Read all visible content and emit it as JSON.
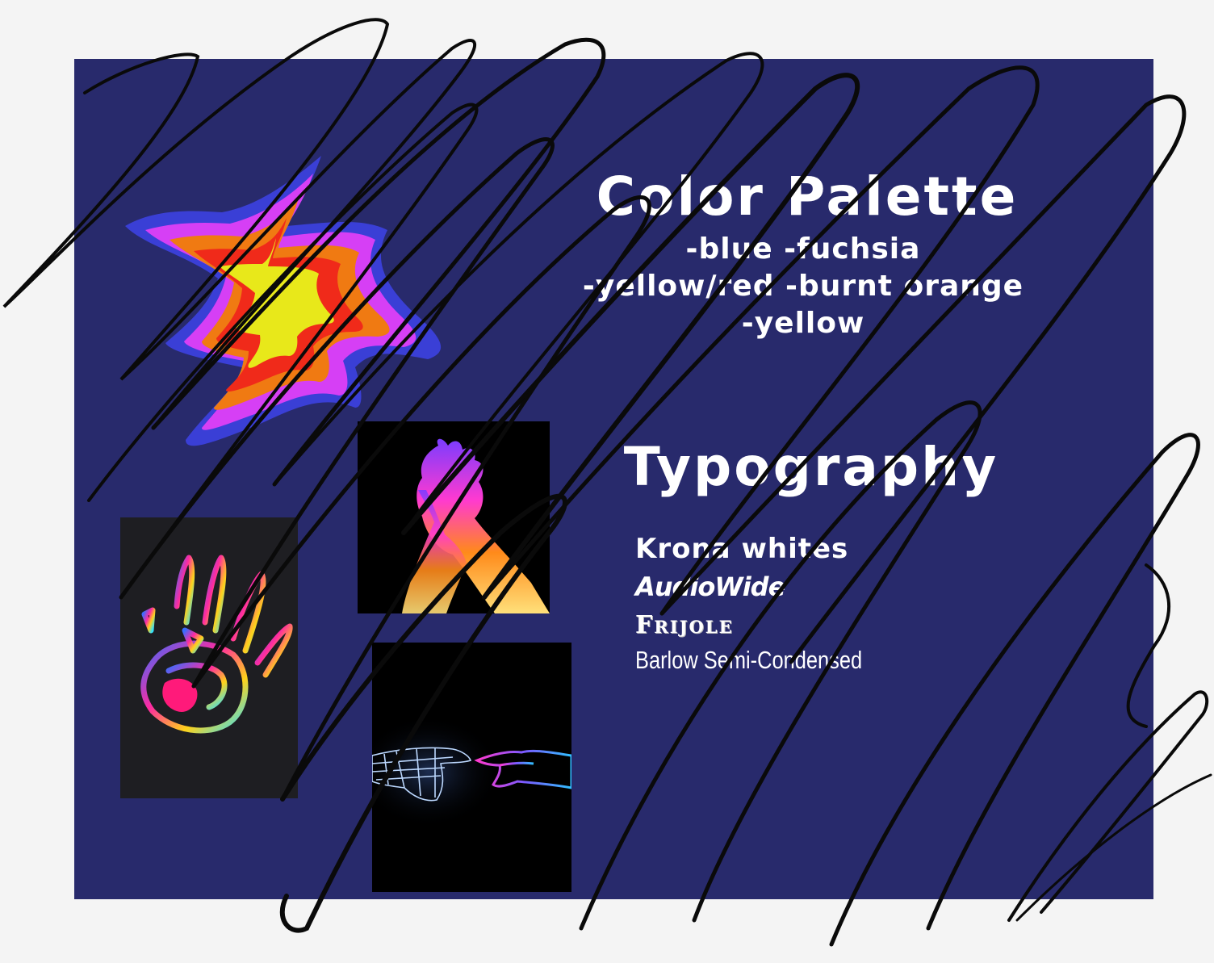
{
  "colors": {
    "board": "#282a6c",
    "text": "#ffffff",
    "scribble": "#0a0a0a",
    "palette_blue": "#3a3fd6",
    "palette_fuchsia": "#d63ff5",
    "palette_burnt_orange": "#f07a12",
    "palette_red": "#f02a1a",
    "palette_yellow": "#e8e81a"
  },
  "color_palette": {
    "title": "Color Palette",
    "line1": "-blue  -fuchsia",
    "line2": "-yellow/red -burnt orange",
    "line3": "-yellow"
  },
  "typography": {
    "title": "Typography",
    "fonts": [
      "Krona whites",
      "AudioWide",
      "Frijole",
      "Barlow Semi-Condensed"
    ]
  },
  "images": {
    "blob_icon": "abstract-flame-shape-icon",
    "handprint_icon": "neon-handprint-icon",
    "hands_glow_icon": "thermal-hands-icon",
    "hands_touch_icon": "wireframe-hands-touching-icon"
  }
}
